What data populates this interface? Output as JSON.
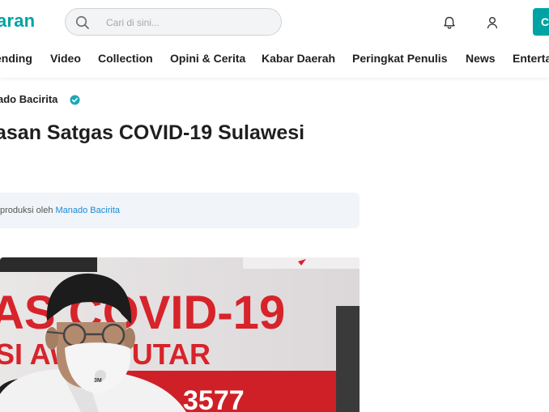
{
  "header": {
    "logo_text": "aran",
    "search": {
      "placeholder": "Cari di sini..."
    },
    "cta_label": "C",
    "brand_color": "#00a3a3",
    "icons": [
      "search-icon",
      "bell-icon",
      "user-icon"
    ]
  },
  "nav": {
    "items": [
      "ending",
      "Video",
      "Collection",
      "Opini & Cerita",
      "Kabar Daerah",
      "Peringkat Penulis",
      "News",
      "Enterta"
    ]
  },
  "article": {
    "author": "ado Bacirita",
    "title": "asan Satgas COVID-19 Sulawesi",
    "info_prefix": "produksi oleh",
    "info_link": "Manado Bacirita",
    "photo": {
      "banner_line1": "AS COVID-19",
      "banner_line2": "SI  AWESI UTAR",
      "banner_number": "3577",
      "mask_mark": "3M"
    }
  }
}
